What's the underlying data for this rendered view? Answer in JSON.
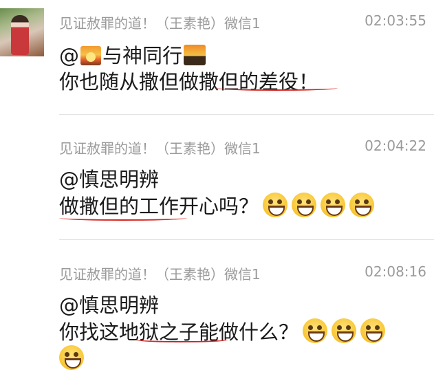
{
  "messages": [
    {
      "sender": "见证赦罪的道！（王素艳）微信1",
      "time": "02:03:55",
      "line1_prefix": "@",
      "line1_name": "与神同行",
      "line2": "你也随从撒但做撒但的差役！"
    },
    {
      "sender": "见证赦罪的道！（王素艳）微信1",
      "time": "02:04:22",
      "line1": "@慎思明辨",
      "line2": "做撒但的工作开心吗？"
    },
    {
      "sender": "见证赦罪的道！（王素艳）微信1",
      "time": "02:08:16",
      "line1": "@慎思明辨",
      "line2": "你找这地狱之子能做什么？"
    }
  ],
  "icons": {
    "avatar": "avatar-photo",
    "sunrise": "sunrise-emoji",
    "cityscape": "city-sunset-emoji",
    "grin": "grinning-face-emoji"
  },
  "colors": {
    "underline": "#d8231f",
    "meta_text": "#9a9a9a",
    "separator": "#e3e3e3"
  }
}
